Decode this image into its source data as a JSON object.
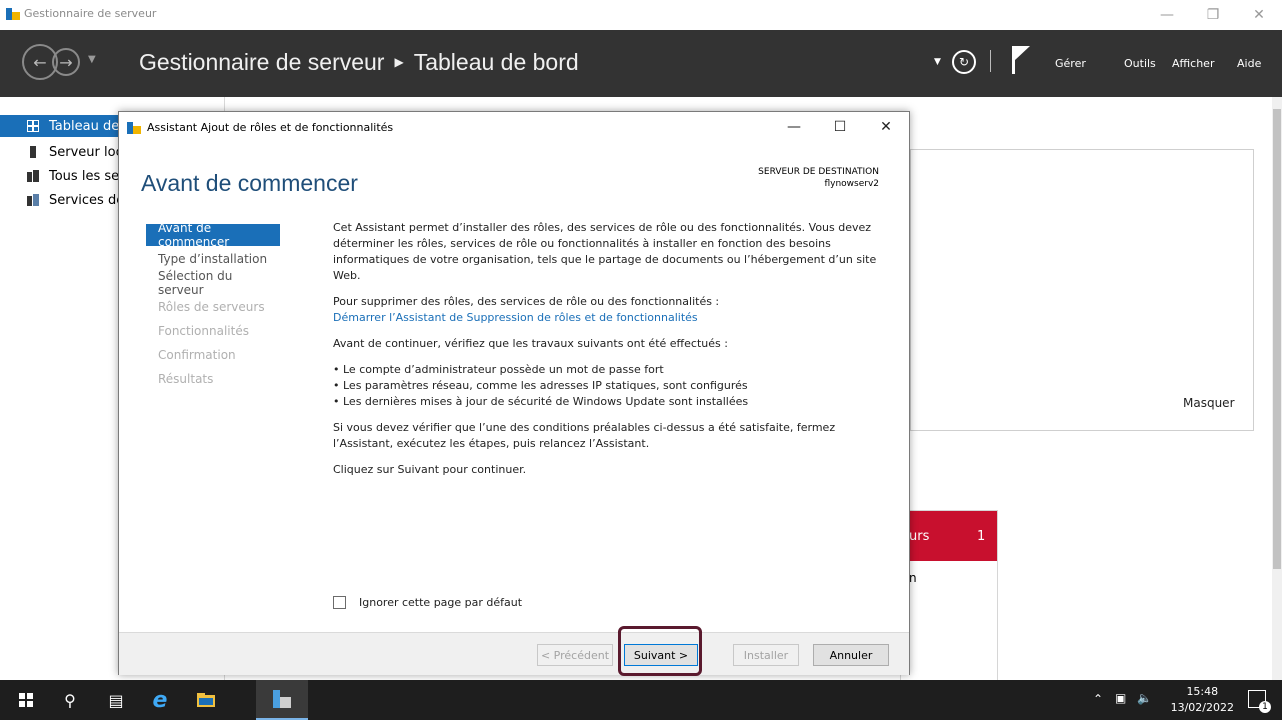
{
  "window": {
    "title": "Gestionnaire de serveur"
  },
  "header": {
    "app": "Gestionnaire de serveur",
    "page": "Tableau de bord",
    "menus": [
      "Gérer",
      "Outils",
      "Afficher",
      "Aide"
    ]
  },
  "leftnav": {
    "items": [
      {
        "label": "Tableau de"
      },
      {
        "label": "Serveur loc"
      },
      {
        "label": "Tous les ser"
      },
      {
        "label": "Services de"
      }
    ]
  },
  "background": {
    "hide_label": "Masquer",
    "tile_fragment": "urs",
    "tile_count": "1",
    "tile_sub": "n"
  },
  "dialog": {
    "title": "Assistant Ajout de rôles et de fonctionnalités",
    "heading": "Avant de commencer",
    "dest_label": "SERVEUR DE DESTINATION",
    "dest_server": "flynowserv2",
    "steps": [
      "Avant de commencer",
      "Type d’installation",
      "Sélection du serveur",
      "Rôles de serveurs",
      "Fonctionnalités",
      "Confirmation",
      "Résultats"
    ],
    "intro": "Cet Assistant permet d’installer des rôles, des services de rôle ou des fonctionnalités. Vous devez déterminer les rôles, services de rôle ou fonctionnalités à installer en fonction des besoins informatiques de votre organisation, tels que le partage de documents ou l’hébergement d’un site Web.",
    "remove_text": "Pour supprimer des rôles, des services de rôle ou des fonctionnalités :",
    "remove_link": "Démarrer l’Assistant de Suppression de rôles et de fonctionnalités",
    "check_text": "Avant de continuer, vérifiez que les travaux suivants ont été effectués :",
    "bullets": [
      "Le compte d’administrateur possède un mot de passe fort",
      "Les paramètres réseau, comme les adresses IP statiques, sont configurés",
      "Les dernières mises à jour de sécurité de Windows Update sont installées"
    ],
    "verify_text": "Si vous devez vérifier que l’une des conditions préalables ci-dessus a été satisfaite, fermez l’Assistant, exécutez les étapes, puis relancez l’Assistant.",
    "next_text": "Cliquez sur Suivant pour continuer.",
    "skip_label": "Ignorer cette page par défaut",
    "buttons": {
      "prev": "< Précédent",
      "next": "Suivant >",
      "install": "Installer",
      "cancel": "Annuler"
    }
  },
  "taskbar": {
    "time": "15:48",
    "date": "13/02/2022",
    "notif_count": "1"
  },
  "colors": {
    "accent": "#1a6fb8",
    "header": "#333333",
    "alert": "#c8102e",
    "highlight": "#5a1a2e"
  }
}
